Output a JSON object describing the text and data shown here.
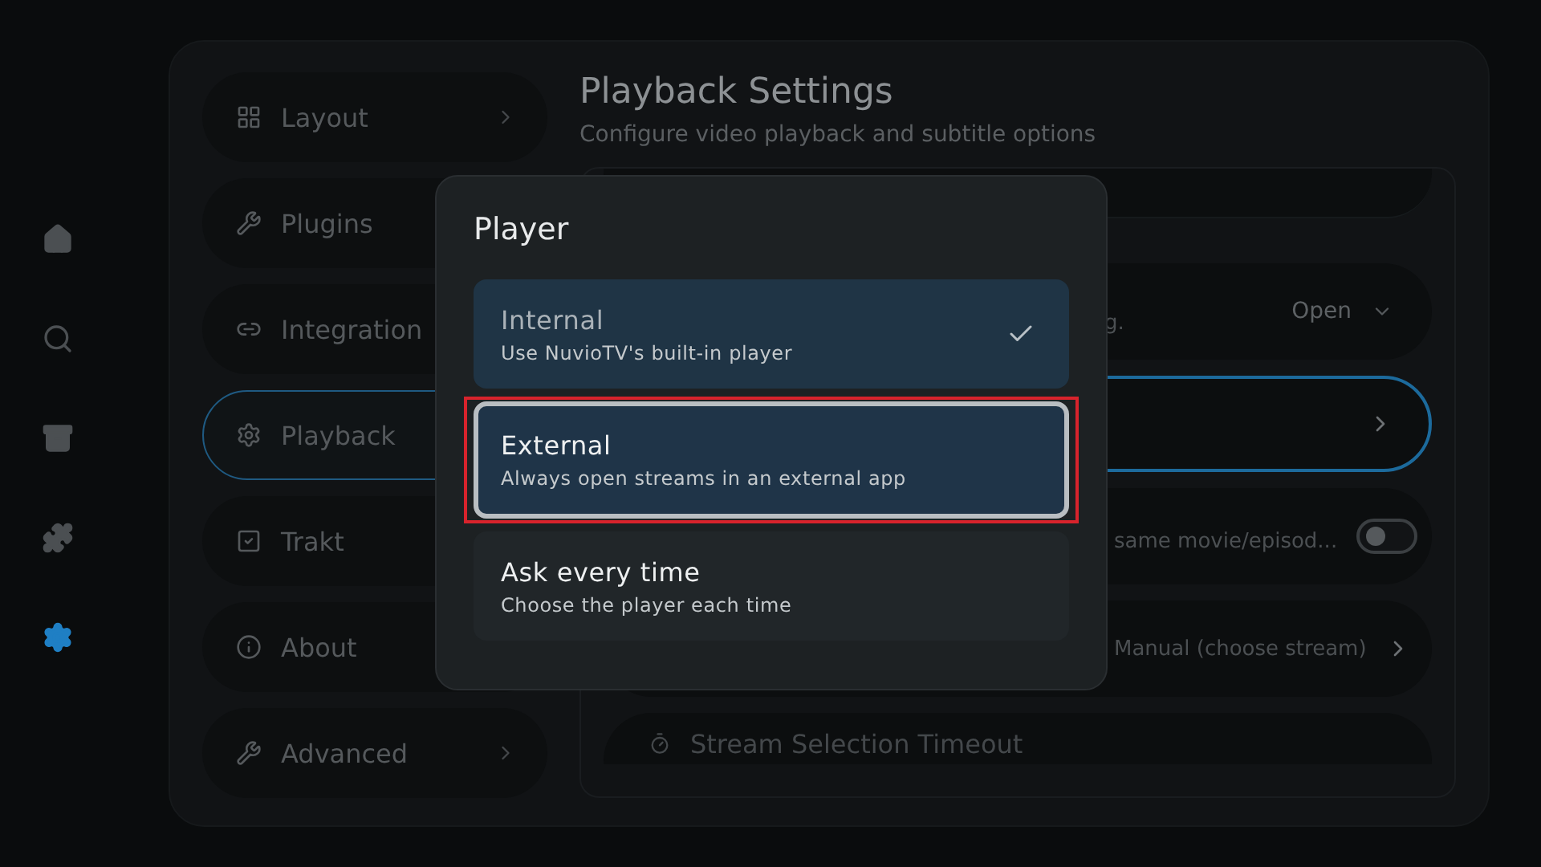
{
  "nav_rail": [
    {
      "selected": false
    },
    {
      "selected": false
    },
    {
      "selected": false
    },
    {
      "selected": false
    },
    {
      "selected": true
    }
  ],
  "sidebar": {
    "items": [
      {
        "label": "Layout",
        "selected": false
      },
      {
        "label": "Plugins",
        "selected": false
      },
      {
        "label": "Integration",
        "selected": false
      },
      {
        "label": "Playback",
        "selected": true
      },
      {
        "label": "Trakt",
        "selected": false
      },
      {
        "label": "About",
        "selected": false
      },
      {
        "label": "Advanced",
        "selected": false
      }
    ]
  },
  "header": {
    "title": "Playback Settings",
    "subtitle": "Configure video playback and subtitle options"
  },
  "settings_rows": [
    {
      "kind": "dropdown",
      "description": "g.",
      "value": "Open",
      "focused": false
    },
    {
      "kind": "link",
      "focused": true
    },
    {
      "kind": "toggle",
      "description": "same movie/episod...",
      "on": false,
      "focused": false
    },
    {
      "kind": "link",
      "description": "Manual (choose stream)",
      "focused": false
    },
    {
      "kind": "heading",
      "title": "Stream Selection Timeout",
      "focused": false
    }
  ],
  "dialog": {
    "title": "Player",
    "options": [
      {
        "title": "Internal",
        "description": "Use NuvioTV's built-in player",
        "selected": true,
        "focused": false
      },
      {
        "title": "External",
        "description": "Always open streams in an external app",
        "selected": false,
        "focused": true
      },
      {
        "title": "Ask every time",
        "description": "Choose the player each time",
        "selected": false,
        "focused": false
      }
    ]
  }
}
